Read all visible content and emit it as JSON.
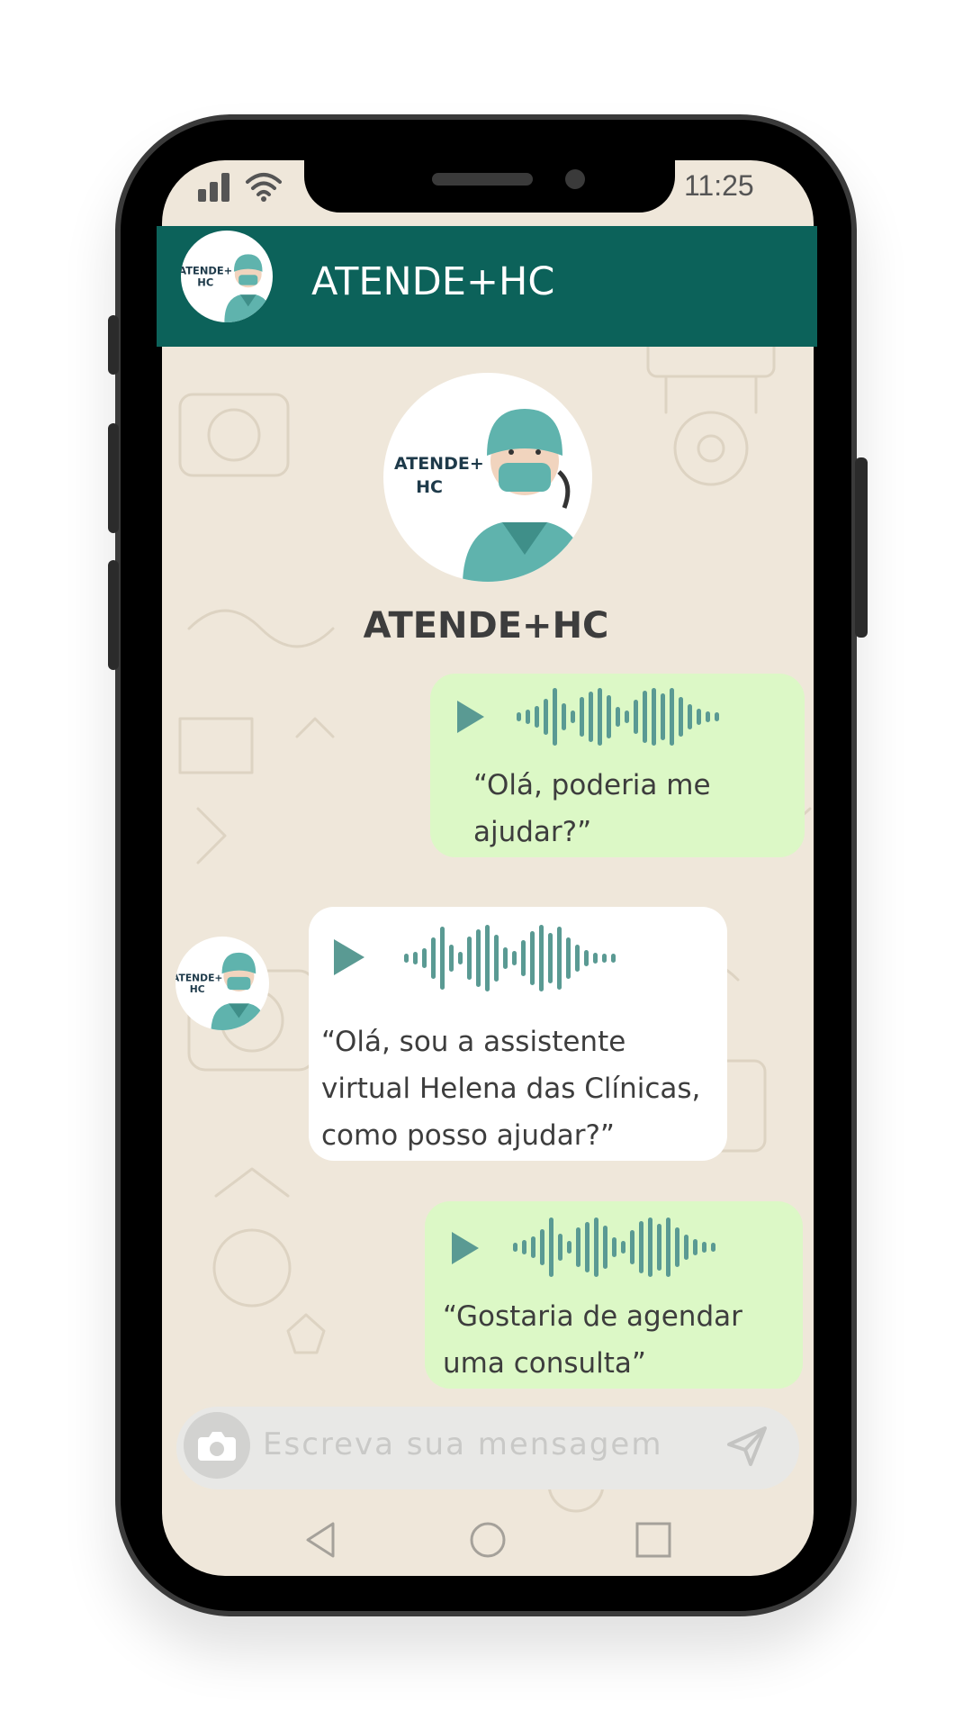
{
  "status_bar": {
    "time": "11:25",
    "signal_icon": "signal-icon",
    "wifi_icon": "wifi-icon"
  },
  "header": {
    "title": "ATENDE+HC",
    "avatar_text": "ATENDE+ HC"
  },
  "profile": {
    "name": "ATENDE+HC",
    "avatar_text": "ATENDE+ HC"
  },
  "messages": [
    {
      "direction": "out",
      "type": "voice",
      "line1": "“Olá, poderia me",
      "line2": "ajudar?”"
    },
    {
      "direction": "in",
      "type": "voice",
      "line1": "“Olá, sou a assistente",
      "line2": "virtual Helena das Clínicas,",
      "line3": "como posso ajudar?”"
    },
    {
      "direction": "out",
      "type": "voice",
      "line1": "“Gostaria de agendar",
      "line2": "uma consulta”"
    }
  ],
  "input": {
    "placeholder": "Escreva sua mensagem",
    "camera_icon": "camera-icon",
    "send_icon": "send-icon"
  },
  "navigation": {
    "back_icon": "back-icon",
    "home_icon": "home-icon",
    "recent_icon": "recent-apps-icon"
  },
  "colors": {
    "header": "#0c625a",
    "outgoing_bubble": "#dcf8c6",
    "incoming_bubble": "#ffffff",
    "chat_background": "#efe7da",
    "accent": "#5a9a93"
  }
}
